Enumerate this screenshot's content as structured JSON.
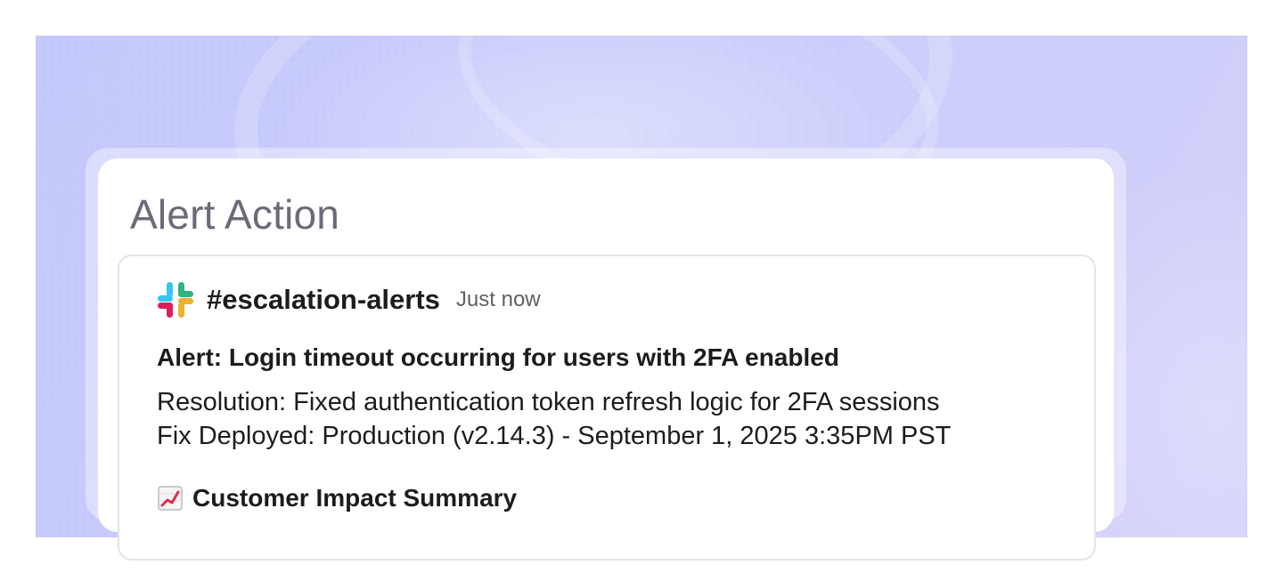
{
  "card": {
    "title": "Alert Action"
  },
  "message": {
    "channel": "#escalation-alerts",
    "timestamp": "Just now",
    "alert": "Alert: Login timeout occurring for users with 2FA enabled",
    "resolution": "Resolution: Fixed authentication token refresh logic for 2FA sessions",
    "deployment": "Fix Deployed: Production (v2.14.3) - September 1, 2025 3:35PM PST",
    "section_title": "Customer Impact Summary",
    "icons": {
      "app": "slack-icon",
      "section": "chart-increasing-icon"
    }
  },
  "colors": {
    "background_start": "#c3c7fb",
    "background_end": "#d2d0fa",
    "title": "#6b6b78",
    "text": "#1d1c1d",
    "muted": "#616061"
  }
}
